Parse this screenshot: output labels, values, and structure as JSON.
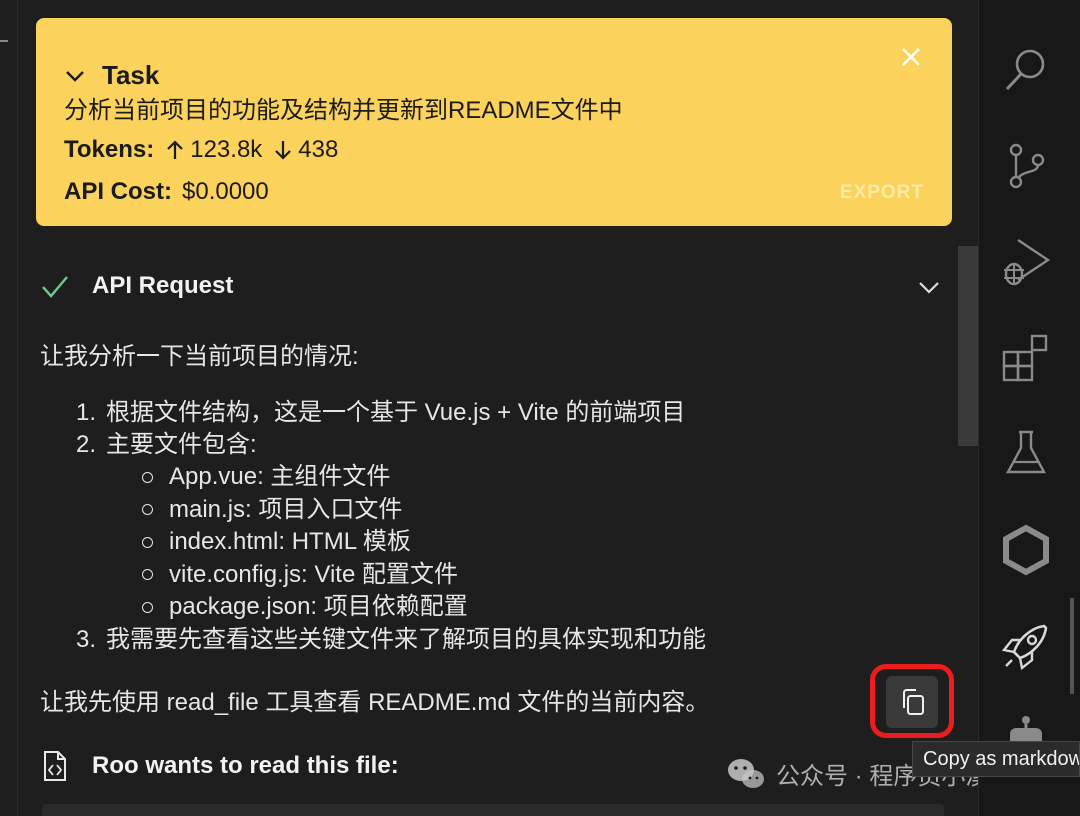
{
  "task": {
    "title": "Task",
    "description": "分析当前项目的功能及结构并更新到README文件中",
    "tokens_label": "Tokens:",
    "tokens_in": "123.8k",
    "tokens_out": "438",
    "cost_label": "API Cost:",
    "cost_value": "$0.0000",
    "export_label": "EXPORT"
  },
  "api_request": {
    "label": "API Request",
    "intro": "让我分析一下当前项目的情况:",
    "steps": [
      "根据文件结构，这是一个基于 Vue.js + Vite 的前端项目",
      "主要文件包含:",
      "我需要先查看这些关键文件来了解项目的具体实现和功能"
    ],
    "step_numbers": [
      "1.",
      "2.",
      "3."
    ],
    "files": [
      "App.vue: 主组件文件",
      "main.js: 项目入口文件",
      "index.html: HTML 模板",
      "vite.config.js: Vite 配置文件",
      "package.json: 项目依赖配置"
    ],
    "followup": "让我先使用 read_file 工具查看 README.md 文件的当前内容。"
  },
  "copy_tooltip": "Copy as markdown",
  "roo": {
    "label": "Roo wants to read this file:"
  },
  "watermark": {
    "text": "公众号 · 程序员小溪"
  },
  "colors": {
    "task_bg": "#fbd35c",
    "background": "#1e1e1e",
    "check": "#73c991",
    "highlight": "#ee1c1c"
  },
  "activity_icons": [
    "search-icon",
    "source-control-icon",
    "run-debug-icon",
    "extensions-icon",
    "testing-icon",
    "hexagon-icon",
    "rocket-icon",
    "robot-icon"
  ]
}
